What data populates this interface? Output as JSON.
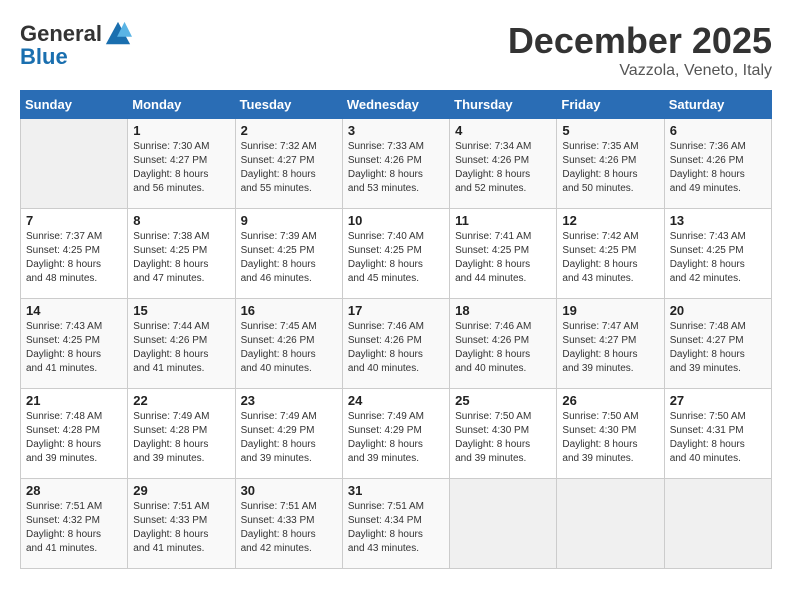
{
  "header": {
    "logo_line1": "General",
    "logo_line2": "Blue",
    "month": "December 2025",
    "location": "Vazzola, Veneto, Italy"
  },
  "weekdays": [
    "Sunday",
    "Monday",
    "Tuesday",
    "Wednesday",
    "Thursday",
    "Friday",
    "Saturday"
  ],
  "weeks": [
    [
      {
        "day": "",
        "info": ""
      },
      {
        "day": "1",
        "info": "Sunrise: 7:30 AM\nSunset: 4:27 PM\nDaylight: 8 hours\nand 56 minutes."
      },
      {
        "day": "2",
        "info": "Sunrise: 7:32 AM\nSunset: 4:27 PM\nDaylight: 8 hours\nand 55 minutes."
      },
      {
        "day": "3",
        "info": "Sunrise: 7:33 AM\nSunset: 4:26 PM\nDaylight: 8 hours\nand 53 minutes."
      },
      {
        "day": "4",
        "info": "Sunrise: 7:34 AM\nSunset: 4:26 PM\nDaylight: 8 hours\nand 52 minutes."
      },
      {
        "day": "5",
        "info": "Sunrise: 7:35 AM\nSunset: 4:26 PM\nDaylight: 8 hours\nand 50 minutes."
      },
      {
        "day": "6",
        "info": "Sunrise: 7:36 AM\nSunset: 4:26 PM\nDaylight: 8 hours\nand 49 minutes."
      }
    ],
    [
      {
        "day": "7",
        "info": "Sunrise: 7:37 AM\nSunset: 4:25 PM\nDaylight: 8 hours\nand 48 minutes."
      },
      {
        "day": "8",
        "info": "Sunrise: 7:38 AM\nSunset: 4:25 PM\nDaylight: 8 hours\nand 47 minutes."
      },
      {
        "day": "9",
        "info": "Sunrise: 7:39 AM\nSunset: 4:25 PM\nDaylight: 8 hours\nand 46 minutes."
      },
      {
        "day": "10",
        "info": "Sunrise: 7:40 AM\nSunset: 4:25 PM\nDaylight: 8 hours\nand 45 minutes."
      },
      {
        "day": "11",
        "info": "Sunrise: 7:41 AM\nSunset: 4:25 PM\nDaylight: 8 hours\nand 44 minutes."
      },
      {
        "day": "12",
        "info": "Sunrise: 7:42 AM\nSunset: 4:25 PM\nDaylight: 8 hours\nand 43 minutes."
      },
      {
        "day": "13",
        "info": "Sunrise: 7:43 AM\nSunset: 4:25 PM\nDaylight: 8 hours\nand 42 minutes."
      }
    ],
    [
      {
        "day": "14",
        "info": "Sunrise: 7:43 AM\nSunset: 4:25 PM\nDaylight: 8 hours\nand 41 minutes."
      },
      {
        "day": "15",
        "info": "Sunrise: 7:44 AM\nSunset: 4:26 PM\nDaylight: 8 hours\nand 41 minutes."
      },
      {
        "day": "16",
        "info": "Sunrise: 7:45 AM\nSunset: 4:26 PM\nDaylight: 8 hours\nand 40 minutes."
      },
      {
        "day": "17",
        "info": "Sunrise: 7:46 AM\nSunset: 4:26 PM\nDaylight: 8 hours\nand 40 minutes."
      },
      {
        "day": "18",
        "info": "Sunrise: 7:46 AM\nSunset: 4:26 PM\nDaylight: 8 hours\nand 40 minutes."
      },
      {
        "day": "19",
        "info": "Sunrise: 7:47 AM\nSunset: 4:27 PM\nDaylight: 8 hours\nand 39 minutes."
      },
      {
        "day": "20",
        "info": "Sunrise: 7:48 AM\nSunset: 4:27 PM\nDaylight: 8 hours\nand 39 minutes."
      }
    ],
    [
      {
        "day": "21",
        "info": "Sunrise: 7:48 AM\nSunset: 4:28 PM\nDaylight: 8 hours\nand 39 minutes."
      },
      {
        "day": "22",
        "info": "Sunrise: 7:49 AM\nSunset: 4:28 PM\nDaylight: 8 hours\nand 39 minutes."
      },
      {
        "day": "23",
        "info": "Sunrise: 7:49 AM\nSunset: 4:29 PM\nDaylight: 8 hours\nand 39 minutes."
      },
      {
        "day": "24",
        "info": "Sunrise: 7:49 AM\nSunset: 4:29 PM\nDaylight: 8 hours\nand 39 minutes."
      },
      {
        "day": "25",
        "info": "Sunrise: 7:50 AM\nSunset: 4:30 PM\nDaylight: 8 hours\nand 39 minutes."
      },
      {
        "day": "26",
        "info": "Sunrise: 7:50 AM\nSunset: 4:30 PM\nDaylight: 8 hours\nand 39 minutes."
      },
      {
        "day": "27",
        "info": "Sunrise: 7:50 AM\nSunset: 4:31 PM\nDaylight: 8 hours\nand 40 minutes."
      }
    ],
    [
      {
        "day": "28",
        "info": "Sunrise: 7:51 AM\nSunset: 4:32 PM\nDaylight: 8 hours\nand 41 minutes."
      },
      {
        "day": "29",
        "info": "Sunrise: 7:51 AM\nSunset: 4:33 PM\nDaylight: 8 hours\nand 41 minutes."
      },
      {
        "day": "30",
        "info": "Sunrise: 7:51 AM\nSunset: 4:33 PM\nDaylight: 8 hours\nand 42 minutes."
      },
      {
        "day": "31",
        "info": "Sunrise: 7:51 AM\nSunset: 4:34 PM\nDaylight: 8 hours\nand 43 minutes."
      },
      {
        "day": "",
        "info": ""
      },
      {
        "day": "",
        "info": ""
      },
      {
        "day": "",
        "info": ""
      }
    ]
  ]
}
